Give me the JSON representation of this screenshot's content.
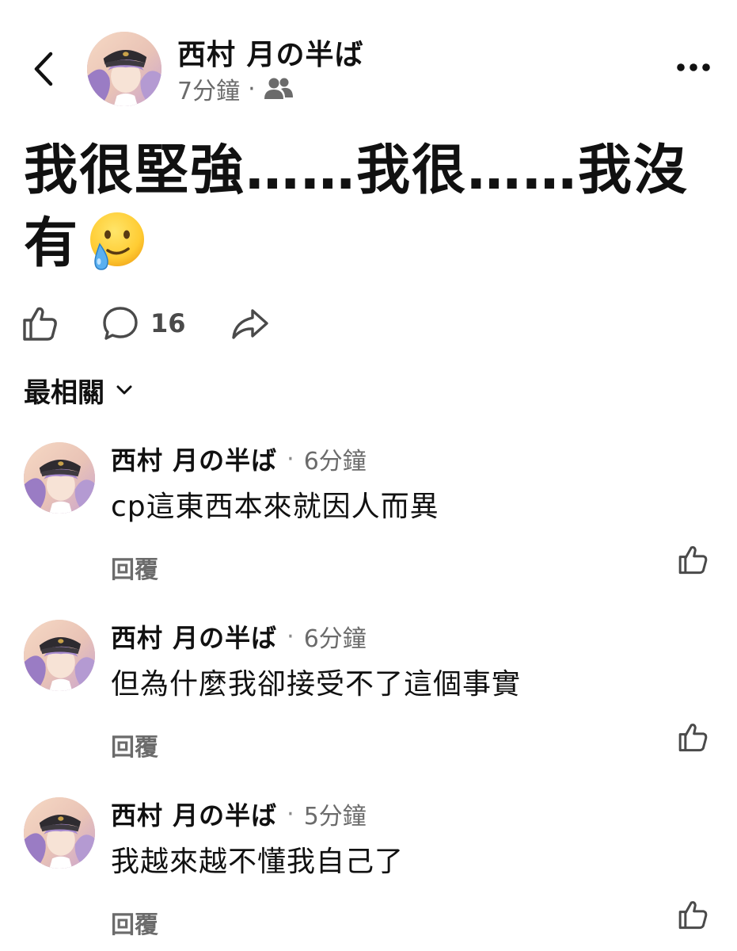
{
  "header": {
    "back_icon": "chevron-left-icon",
    "author": "西村 月の半ば",
    "time": "7分鐘",
    "separator": "·",
    "audience_icon": "friends-icon",
    "more_icon": "more-horizontal-icon"
  },
  "post": {
    "text": "我很堅強……我很……我沒有",
    "emoji": "face-holding-back-tears"
  },
  "actions": {
    "like_icon": "thumbs-up-icon",
    "comment_icon": "comment-bubble-icon",
    "comment_count": "16",
    "share_icon": "share-arrow-icon"
  },
  "sort": {
    "label": "最相關",
    "icon": "chevron-down-icon"
  },
  "comments": [
    {
      "author": "西村 月の半ば",
      "separator": "·",
      "time": "6分鐘",
      "text": "cp這東西本來就因人而異",
      "reply_label": "回覆"
    },
    {
      "author": "西村 月の半ば",
      "separator": "·",
      "time": "6分鐘",
      "text": "但為什麼我卻接受不了這個事實",
      "reply_label": "回覆"
    },
    {
      "author": "西村 月の半ば",
      "separator": "·",
      "time": "5分鐘",
      "text": "我越來越不懂我自己了",
      "reply_label": "回覆"
    }
  ],
  "colors": {
    "text_primary": "#111111",
    "text_secondary": "#6b6b6b",
    "icon_gray": "#4a4a4a",
    "background": "#ffffff"
  }
}
